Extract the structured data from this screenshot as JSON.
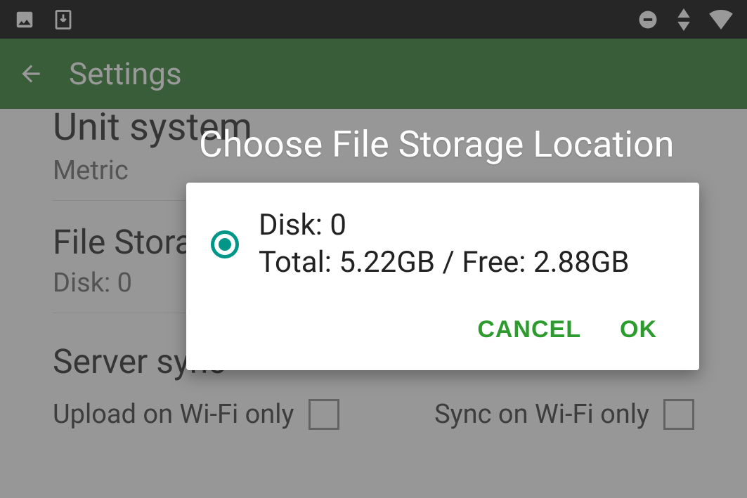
{
  "status_icons": {
    "left": [
      "image-icon",
      "download-icon"
    ],
    "right": [
      "dnd-icon",
      "sort-icon",
      "wifi-icon"
    ]
  },
  "appbar": {
    "title": "Settings"
  },
  "settings": {
    "unit_system": {
      "title": "Unit system",
      "value": "Metric"
    },
    "file_storage": {
      "title": "File Storage",
      "value": "Disk: 0"
    },
    "server_section": {
      "title": "Server sync"
    },
    "upload_wifi_only": {
      "label": "Upload on Wi-Fi only",
      "checked": false
    },
    "sync_wifi_only": {
      "label": "Sync on Wi-Fi only",
      "checked": false
    }
  },
  "dialog": {
    "title": "Choose File Storage Location",
    "option": {
      "line1": "Disk: 0",
      "line2": "Total: 5.22GB / Free: 2.88GB",
      "selected": true
    },
    "cancel": "CANCEL",
    "ok": "OK"
  },
  "colors": {
    "primary_green": "#2a7a2a",
    "action_green": "#2d9b2d",
    "teal_accent": "#009688"
  }
}
